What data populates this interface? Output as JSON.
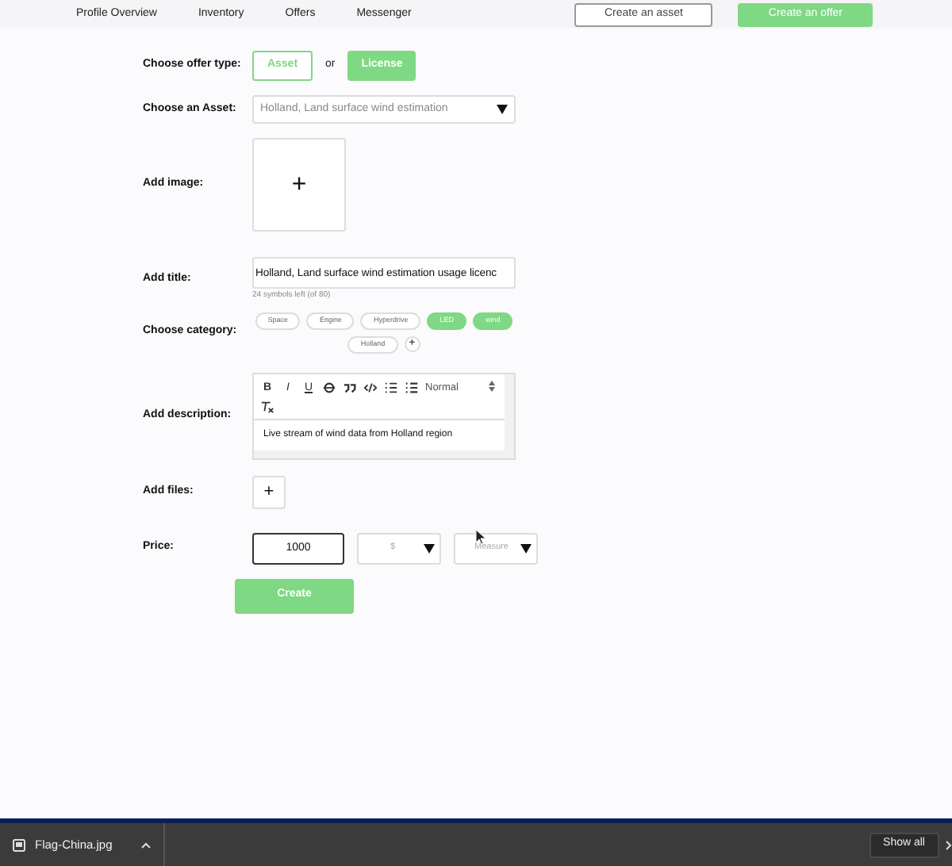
{
  "nav": {
    "links": [
      {
        "label": "Profile Overview"
      },
      {
        "label": "Inventory"
      },
      {
        "label": "Offers"
      },
      {
        "label": "Messenger"
      }
    ],
    "buttons": [
      {
        "label": "Create an asset",
        "kind": "outline"
      },
      {
        "label": "Create an offer",
        "kind": "primary"
      }
    ]
  },
  "form": {
    "offer_type": {
      "label": "Choose offer type:",
      "or": "or",
      "options": [
        {
          "label": "Asset",
          "selected": false
        },
        {
          "label": "License",
          "selected": true
        }
      ]
    },
    "asset": {
      "label": "Choose an Asset:",
      "value": "Holland, Land surface wind estimation"
    },
    "image": {
      "label": "Add image:",
      "button": "+"
    },
    "title": {
      "label": "Add title:",
      "value": "Holland, Land surface wind estimation usage licenc",
      "hint": "24 symbols left (of 80)"
    },
    "category": {
      "label": "Choose category:",
      "chips": [
        {
          "label": "Space",
          "selected": false
        },
        {
          "label": "Engine",
          "selected": false
        },
        {
          "label": "Hyperdrive",
          "selected": false
        },
        {
          "label": "LED",
          "selected": true
        },
        {
          "label": "wind",
          "selected": true
        },
        {
          "label": "Holland",
          "selected": false
        }
      ],
      "add": "+"
    },
    "description": {
      "label": "Add description:",
      "toolbar": [
        {
          "kind": "bold",
          "label": "B"
        },
        {
          "kind": "italic",
          "label": "I"
        },
        {
          "kind": "underline",
          "label": "U"
        },
        {
          "kind": "strike"
        },
        {
          "kind": "quote"
        },
        {
          "kind": "code"
        },
        {
          "kind": "ordered-list"
        },
        {
          "kind": "bullet-list"
        },
        {
          "kind": "select",
          "label": "Normal"
        },
        {
          "kind": "clear"
        }
      ],
      "text": "Live stream of wind data from Holland region"
    },
    "files": {
      "label": "Add files:",
      "button": "+"
    },
    "price": {
      "label": "Price:",
      "value": "1000",
      "currency": "$",
      "measure": "Measure"
    },
    "submit": "Create"
  },
  "download_bar": {
    "file": "Flag-China.jpg",
    "show_all": "Show all"
  }
}
